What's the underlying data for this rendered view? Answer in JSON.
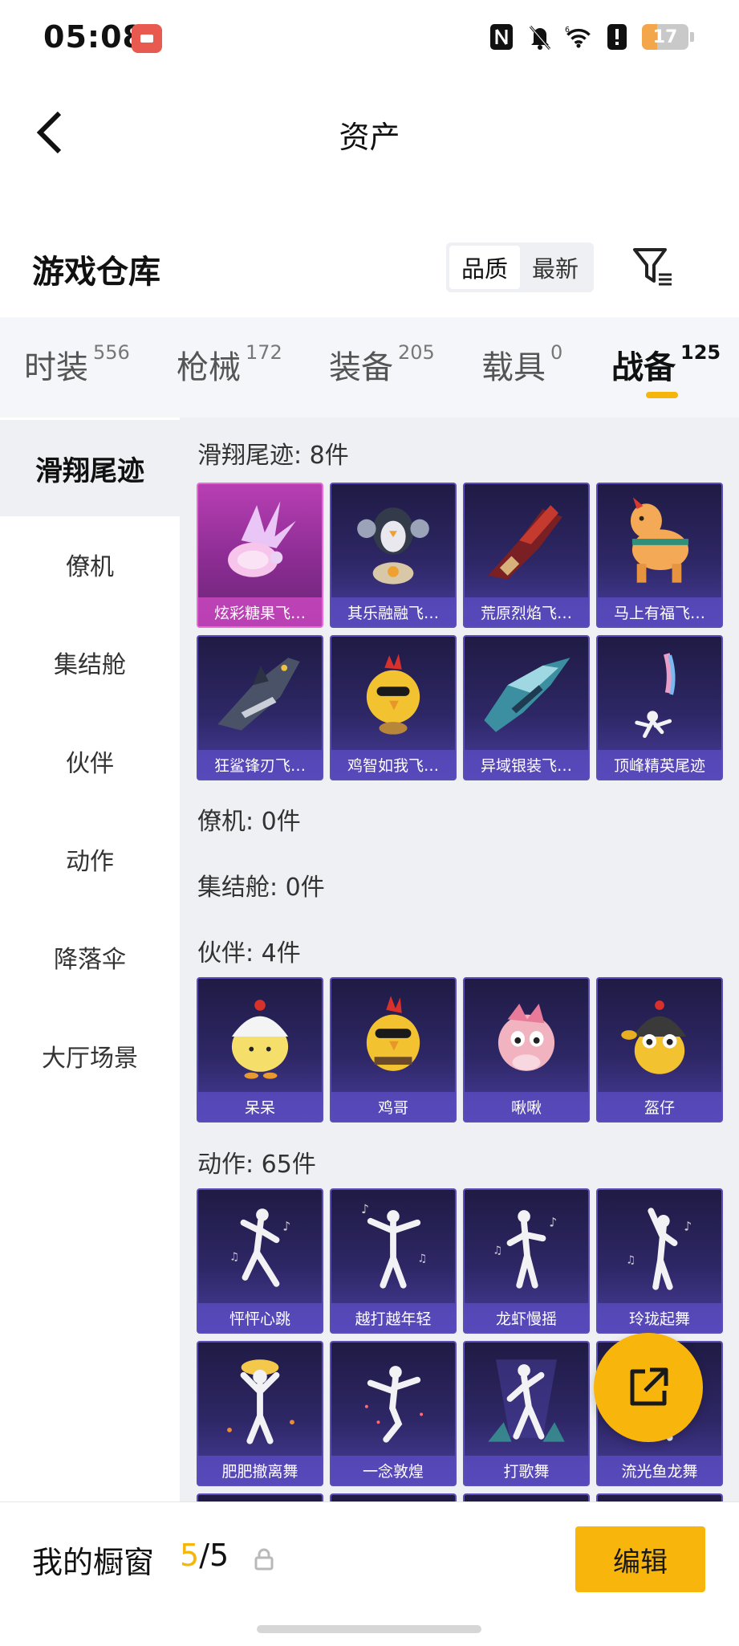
{
  "status_bar": {
    "time": "05:08",
    "battery_level": "17",
    "icons": [
      "nfc-icon",
      "mute-icon",
      "wifi-6-icon",
      "alert-icon",
      "battery-icon"
    ]
  },
  "header": {
    "title": "资产"
  },
  "warehouse": {
    "title": "游戏仓库",
    "sort_options": [
      "品质",
      "最新"
    ],
    "sort_active": "品质"
  },
  "tabs": [
    {
      "label": "时装",
      "count": "556"
    },
    {
      "label": "枪械",
      "count": "172"
    },
    {
      "label": "装备",
      "count": "205"
    },
    {
      "label": "载具",
      "count": "0"
    },
    {
      "label": "战备",
      "count": "125"
    }
  ],
  "active_tab": "战备",
  "sidebar": {
    "items": [
      "滑翔尾迹",
      "僚机",
      "集结舱",
      "伙伴",
      "动作",
      "降落伞",
      "大厅场景"
    ],
    "active": "滑翔尾迹"
  },
  "sections": {
    "glide_trail": {
      "header": "滑翔尾迹: 8件",
      "items": [
        "炫彩糖果飞…",
        "其乐融融飞…",
        "荒原烈焰飞…",
        "马上有福飞…",
        "狂鲨锋刃飞…",
        "鸡智如我飞…",
        "异域银装飞…",
        "顶峰精英尾迹"
      ]
    },
    "wingman": {
      "header": "僚机: 0件"
    },
    "rally_pod": {
      "header": "集结舱: 0件"
    },
    "companion": {
      "header": "伙伴: 4件",
      "items": [
        "呆呆",
        "鸡哥",
        "啾啾",
        "盔仔"
      ]
    },
    "emote": {
      "header": "动作: 65件",
      "items": [
        "怦怦心跳",
        "越打越年轻",
        "龙虾慢摇",
        "玲珑起舞",
        "肥肥撤离舞",
        "一念敦煌",
        "打歌舞",
        "流光鱼龙舞"
      ]
    }
  },
  "bottom_bar": {
    "showcase_title": "我的橱窗",
    "showcase_current": "5",
    "showcase_total": "/5",
    "edit_label": "编辑"
  },
  "colors": {
    "accent": "#f8b60d",
    "card_bg": "#2e2766",
    "card_selected": "#b83fb3"
  }
}
